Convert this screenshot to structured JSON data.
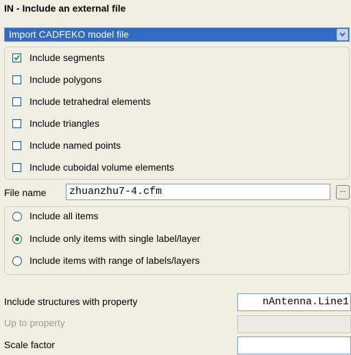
{
  "title": "IN - Include an external file",
  "combo": {
    "value": "Import CADFEKO model file"
  },
  "include_options": [
    {
      "label": "Include segments",
      "checked": true
    },
    {
      "label": "Include polygons",
      "checked": false
    },
    {
      "label": "Include tetrahedral elements",
      "checked": false
    },
    {
      "label": "Include triangles",
      "checked": false
    },
    {
      "label": "Include named points",
      "checked": false
    },
    {
      "label": "Include cuboidal volume elements",
      "checked": false
    }
  ],
  "file": {
    "label": "File name",
    "value": "zhuanzhu7-4.cfm",
    "browse_label": "..."
  },
  "item_options": [
    {
      "label": "Include all items",
      "selected": false
    },
    {
      "label": "Include only items with single label/layer",
      "selected": true
    },
    {
      "label": "Include items with range of labels/layers",
      "selected": false
    }
  ],
  "properties": {
    "include_structures": {
      "label": "Include structures with property",
      "value": "nAntenna.Line1"
    },
    "up_to": {
      "label": "Up to property",
      "value": ""
    },
    "scale": {
      "label": "Scale factor",
      "value": ""
    }
  },
  "colors": {
    "selection": "#316ac5",
    "background": "#f1efe2",
    "radio_dot": "#21a121"
  }
}
